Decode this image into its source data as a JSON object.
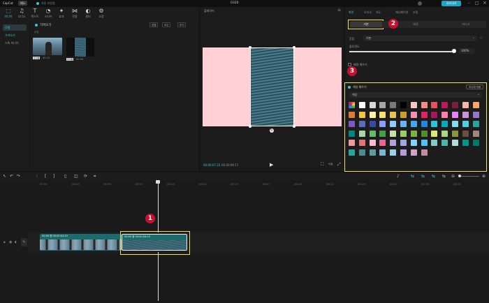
{
  "app": {
    "title": "0320",
    "menu_logo": "CapCut",
    "menu_pill": "메뉴",
    "project_status": "자동 저장됨",
    "export_label": "내보내기"
  },
  "topnav": [
    {
      "label": "미디어",
      "icon": "media-icon"
    },
    {
      "label": "오디오",
      "icon": "audio-icon"
    },
    {
      "label": "텍스트",
      "icon": "text-icon"
    },
    {
      "label": "스티커",
      "icon": "sticker-icon"
    },
    {
      "label": "효과",
      "icon": "effects-icon"
    },
    {
      "label": "전환",
      "icon": "transition-icon"
    },
    {
      "label": "필터",
      "icon": "filter-icon"
    },
    {
      "label": "조정",
      "icon": "adjust-icon"
    }
  ],
  "sidebar": {
    "items": [
      "로컬",
      "가져오기",
      "스톡 미디어"
    ]
  },
  "media": {
    "import_label": "가져오기",
    "section_label": "로컬",
    "toolbar": [
      "정렬",
      "모두",
      "보기"
    ],
    "clip1": {
      "tag": "추가됨",
      "duration": "00:10"
    },
    "clip2": {
      "tag": "추가됨",
      "duration": "00:08"
    }
  },
  "preview": {
    "title": "플레이어",
    "time_current": "00:00:07:23",
    "time_total": "00:00:09:17",
    "ratio_label": "비율"
  },
  "inspector": {
    "tabs": [
      "화면",
      "오디오",
      "속도",
      "애니메이션",
      "조정"
    ],
    "subtabs": [
      "기본",
      "배경",
      "마스크"
    ],
    "blend_label": "혼합",
    "blend_value": "기본",
    "opacity_label": "불투명도",
    "opacity_value": "100%",
    "bg_check_label": "배경 채우기",
    "color_panel_title": "색상 채우기",
    "apply_all_label": "모두에 적용",
    "color_dropdown": "색상"
  },
  "palette": [
    "rainbow",
    "#ffffff",
    "#d9d9d9",
    "#a6a6a6",
    "#7a7a7a",
    "#000000",
    "#f7c6c0",
    "#f28b82",
    "#e8505b",
    "#c2185b",
    "#7b1e3a",
    "#f6b4a8",
    "#f9a66c",
    "#e07a2f",
    "#f5c542",
    "#fff3a0",
    "#f7e36b",
    "#e8c547",
    "#c9a227",
    "#f48fb1",
    "#e91e63",
    "#ad1457",
    "#ff80ab",
    "#ea80fc",
    "#ce93d8",
    "#9575cd",
    "#7e57c2",
    "#5c6bc0",
    "#3949ab",
    "#8c9eff",
    "#90caf9",
    "#64b5f6",
    "#42a5f5",
    "#1e88e5",
    "#26c6da",
    "#00acc1",
    "#80deea",
    "#4dd0e1",
    "#26a69a",
    "#00897b",
    "#a5d6a7",
    "#66bb6a",
    "#43a047",
    "#c5e1a5",
    "#9ccc65",
    "#7cb342",
    "#558b2f",
    "#dce775",
    "#aed581",
    "#8d9440",
    "#6d4c41",
    "#a1887f",
    "#ef9a9a",
    "#e57373",
    "#f8bbd0",
    "#f06292",
    "#b39ddb",
    "#9fa8da",
    "#81d4fa",
    "#4fc3f7",
    "#80cbc4",
    "#4db6ac",
    "#b2dfdb",
    "#009688",
    "#00796b",
    "#26a69a",
    "#4a8c8c",
    "#5c9ea0",
    "#7fb3d5",
    "#9ad0ec",
    "#b39ddb",
    "#d1a3c4",
    "#c48b9f"
  ],
  "timeline": {
    "ticks": [
      "00:00",
      "|00:03",
      "|00:05",
      "|00:07",
      "|00:10",
      "|00:12",
      "|00:15",
      "|00:17",
      "|00:20",
      "|00:22",
      "|00:25",
      "|00:27",
      "|00:30",
      "|00:32"
    ],
    "clip1_label": "00:00 중 00:00:04:10",
    "clip2_label": "00:00 중 00:00:04:10",
    "track_label": "커버"
  },
  "badges": [
    "1",
    "2",
    "3"
  ]
}
